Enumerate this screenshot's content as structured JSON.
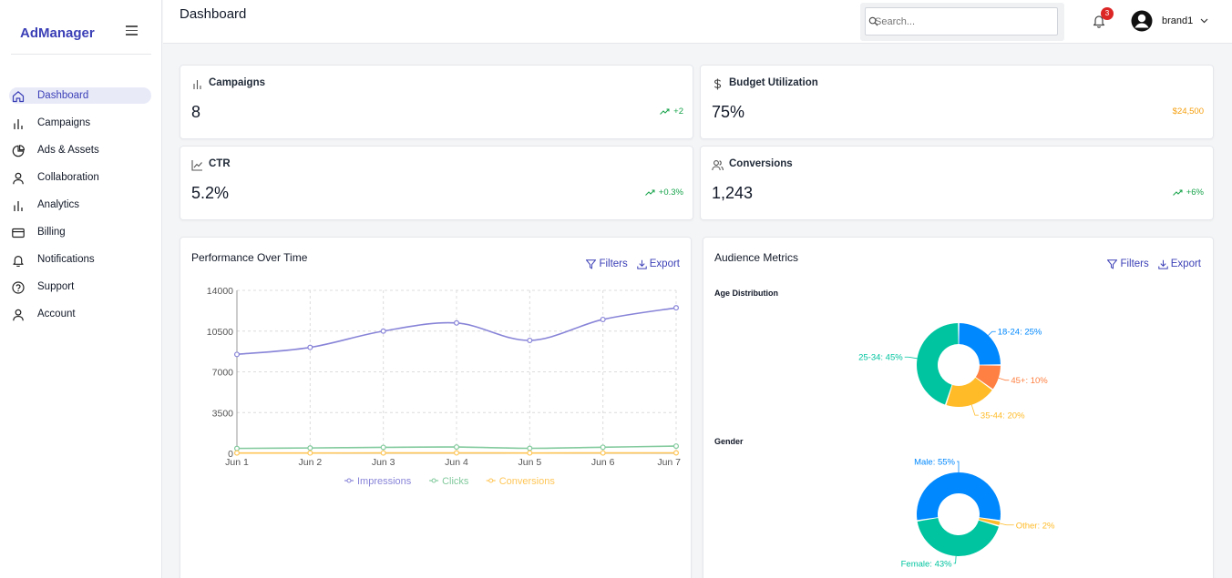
{
  "app": {
    "name": "AdManager"
  },
  "nav": {
    "items": [
      {
        "label": "Dashboard",
        "icon": "home-icon",
        "active": true
      },
      {
        "label": "Campaigns",
        "icon": "bar-chart-icon"
      },
      {
        "label": "Ads & Assets",
        "icon": "pie-chart-icon"
      },
      {
        "label": "Collaboration",
        "icon": "user-icon"
      },
      {
        "label": "Analytics",
        "icon": "bar-chart-icon"
      },
      {
        "label": "Billing",
        "icon": "credit-card-icon"
      },
      {
        "label": "Notifications",
        "icon": "bell-icon"
      },
      {
        "label": "Support",
        "icon": "help-circle-icon"
      },
      {
        "label": "Account",
        "icon": "user-icon"
      }
    ]
  },
  "header": {
    "title": "Dashboard",
    "search_placeholder": "Search...",
    "notification_count": "3",
    "username": "brand1"
  },
  "stats": {
    "campaigns": {
      "title": "Campaigns",
      "value": "8",
      "delta": "+2"
    },
    "budget": {
      "title": "Budget Utilization",
      "value": "75%",
      "delta": "$24,500"
    },
    "ctr": {
      "title": "CTR",
      "value": "5.2%",
      "delta": "+0.3%"
    },
    "conversions": {
      "title": "Conversions",
      "value": "1,243",
      "delta": "+6%"
    }
  },
  "performance": {
    "title": "Performance Over Time",
    "filters_label": "Filters",
    "export_label": "Export"
  },
  "audience": {
    "title": "Audience Metrics",
    "filters_label": "Filters",
    "export_label": "Export",
    "age_label": "Age Distribution",
    "gender_label": "Gender"
  },
  "colors": {
    "accent": "#3b3fb6",
    "impressions": "#8884d8",
    "clicks": "#82ca9d",
    "conversions": "#ffc658",
    "blue": "#0088fe",
    "teal": "#00c49f",
    "yellow": "#ffbb28",
    "orange": "#ff8042"
  },
  "chart_data": [
    {
      "type": "line",
      "x": [
        "Jun 1",
        "Jun 2",
        "Jun 3",
        "Jun 4",
        "Jun 5",
        "Jun 6",
        "Jun 7"
      ],
      "ylim": [
        0,
        14000
      ],
      "yticks": [
        "0",
        "3500",
        "7000",
        "10500",
        "14000"
      ],
      "grid": true,
      "legend": "bottom",
      "series": [
        {
          "name": "Impressions",
          "values": [
            8500,
            9100,
            10500,
            11200,
            9700,
            11500,
            12500
          ],
          "color": "#8884d8"
        },
        {
          "name": "Clicks",
          "values": [
            420,
            460,
            510,
            540,
            430,
            520,
            620
          ],
          "color": "#82ca9d"
        },
        {
          "name": "Conversions",
          "values": [
            25,
            28,
            32,
            35,
            27,
            33,
            40
          ],
          "color": "#ffc658"
        }
      ]
    },
    {
      "type": "pie",
      "title": "Age Distribution",
      "categories": [
        "18-24",
        "45+",
        "35-44",
        "25-34"
      ],
      "labels": [
        "18-24: 25%",
        "45+: 10%",
        "35-44: 20%",
        "25-34: 45%"
      ],
      "values": [
        25,
        10,
        20,
        45
      ],
      "colors": [
        "#0088fe",
        "#ff8042",
        "#ffbb28",
        "#00c49f"
      ]
    },
    {
      "type": "pie",
      "title": "Gender",
      "categories": [
        "Male",
        "Other",
        "Female"
      ],
      "labels": [
        "Male: 55%",
        "Other: 2%",
        "Female: 43%"
      ],
      "values": [
        55,
        2,
        43
      ],
      "colors": [
        "#0088fe",
        "#ffbb28",
        "#00c49f"
      ]
    }
  ]
}
